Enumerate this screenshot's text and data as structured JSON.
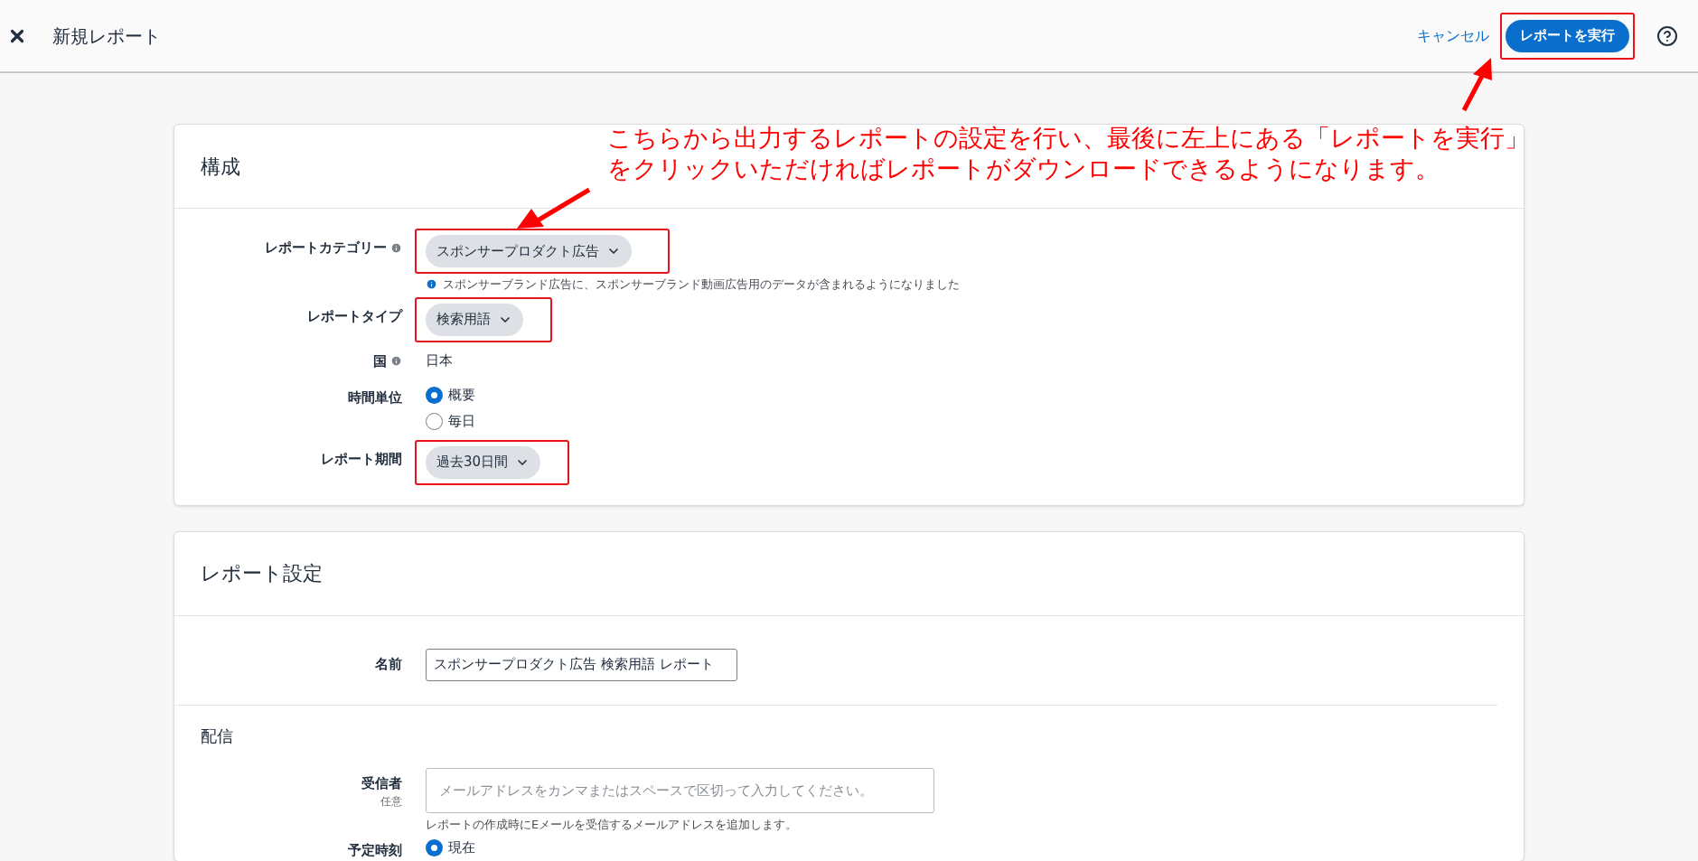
{
  "header": {
    "title": "新規レポート",
    "cancel": "キャンセル",
    "run_button": {
      "label": "レポートを実行",
      "highlighted": true
    }
  },
  "annotation": {
    "lines": [
      "こちらから出力するレポートの設定を行い、最後に左上にある「レポートを実行」",
      "をクリックいただければレポートがダウンロードできるようになります。"
    ]
  },
  "config": {
    "title": "構成",
    "fields": [
      {
        "kind": "dropdown",
        "label": "レポートカテゴリー",
        "info": true,
        "value": "スポンサープロダクト広告",
        "highlighted": true,
        "note": "スポンサーブランド広告に、スポンサーブランド動画広告用のデータが含まれるようになりました"
      },
      {
        "kind": "dropdown",
        "label": "レポートタイプ",
        "info": false,
        "value": "検索用語",
        "highlighted": true
      },
      {
        "kind": "text",
        "label": "国",
        "info": true,
        "value": "日本"
      },
      {
        "kind": "radio",
        "label": "時間単位",
        "info": false,
        "options": [
          {
            "label": "概要",
            "selected": true
          },
          {
            "label": "毎日",
            "selected": false
          }
        ]
      },
      {
        "kind": "dropdown",
        "label": "レポート期間",
        "info": false,
        "value": "過去30日間",
        "highlighted": true
      }
    ]
  },
  "settings": {
    "title": "レポート設定",
    "name": {
      "label": "名前",
      "value": "スポンサープロダクト広告 検索用語 レポート"
    },
    "delivery": {
      "title": "配信",
      "recipients": {
        "label": "受信者",
        "sublabel": "任意",
        "placeholder": "メールアドレスをカンマまたはスペースで区切って入力してください。",
        "help": "レポートの作成時にEメールを受信するメールアドレスを追加します。"
      },
      "schedule": {
        "label": "予定時刻",
        "options": [
          {
            "label": "現在",
            "selected": true
          }
        ]
      }
    }
  }
}
